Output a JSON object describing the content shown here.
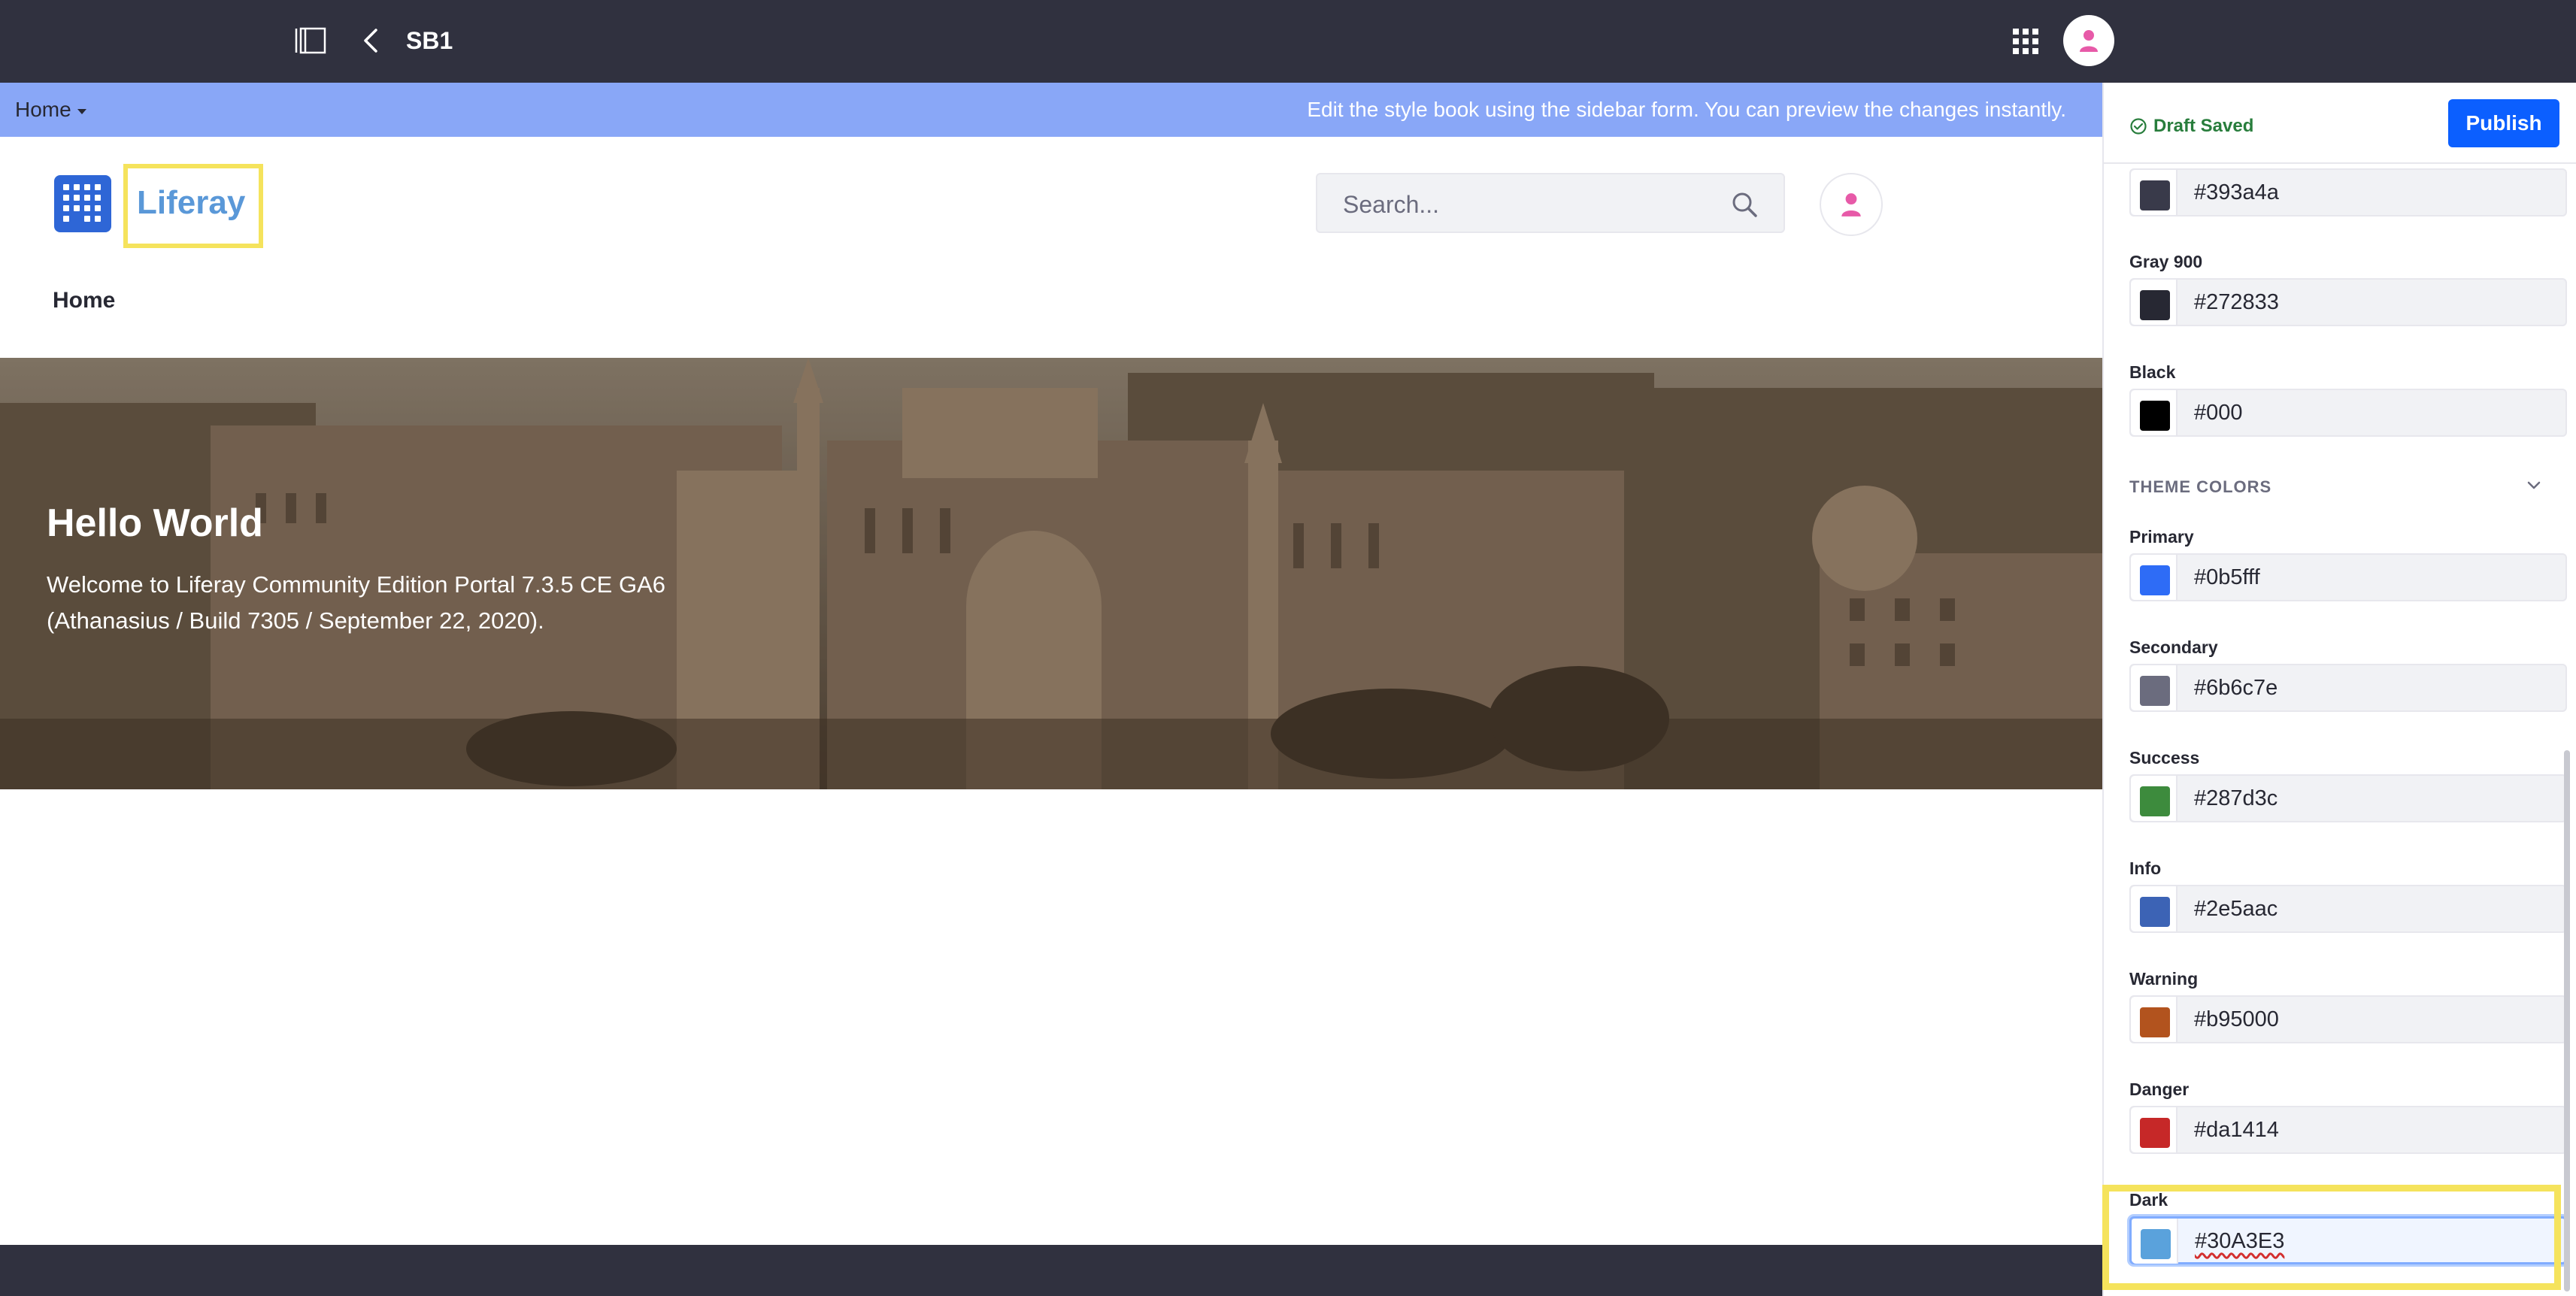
{
  "topbar": {
    "title": "SB1",
    "icons": [
      "sidebar-toggle-icon",
      "back-icon",
      "apps-grid-icon",
      "user-avatar-icon"
    ]
  },
  "infobar": {
    "page_select": "Home",
    "message": "Edit the style book using the sidebar form. You can preview the changes instantly."
  },
  "site": {
    "logo_name": "Liferay",
    "search_placeholder": "Search...",
    "nav": [
      "Home"
    ],
    "hero": {
      "title": "Hello World",
      "text": "Welcome to Liferay Community Edition Portal 7.3.5 CE GA6 (Athanasius / Build 7305 / September 22, 2020)."
    }
  },
  "sidebar": {
    "status": "Draft Saved",
    "publish_label": "Publish",
    "theme_section": "THEME COLORS",
    "fields": [
      {
        "label": "",
        "value": "#393a4a",
        "color": "#393a4a"
      },
      {
        "label": "Gray 900",
        "value": "#272833",
        "color": "#272833"
      },
      {
        "label": "Black",
        "value": "#000",
        "color": "#000000"
      },
      {
        "label": "Primary",
        "value": "#0b5fff",
        "color": "#2e6cf6"
      },
      {
        "label": "Secondary",
        "value": "#6b6c7e",
        "color": "#6b6c7e"
      },
      {
        "label": "Success",
        "value": "#287d3c",
        "color": "#3d8b3d"
      },
      {
        "label": "Info",
        "value": "#2e5aac",
        "color": "#3c63b5"
      },
      {
        "label": "Warning",
        "value": "#b95000",
        "color": "#b2531e"
      },
      {
        "label": "Danger",
        "value": "#da1414",
        "color": "#c62828"
      },
      {
        "label": "Dark",
        "value": "#30A3E3",
        "color": "#5aa2dc"
      }
    ]
  },
  "colors": {
    "control_bar": "#30313f",
    "info_strip": "#89a7f7",
    "highlight": "#f5e35c",
    "publish": "#0b5fff",
    "draft_saved": "#287d3c"
  }
}
